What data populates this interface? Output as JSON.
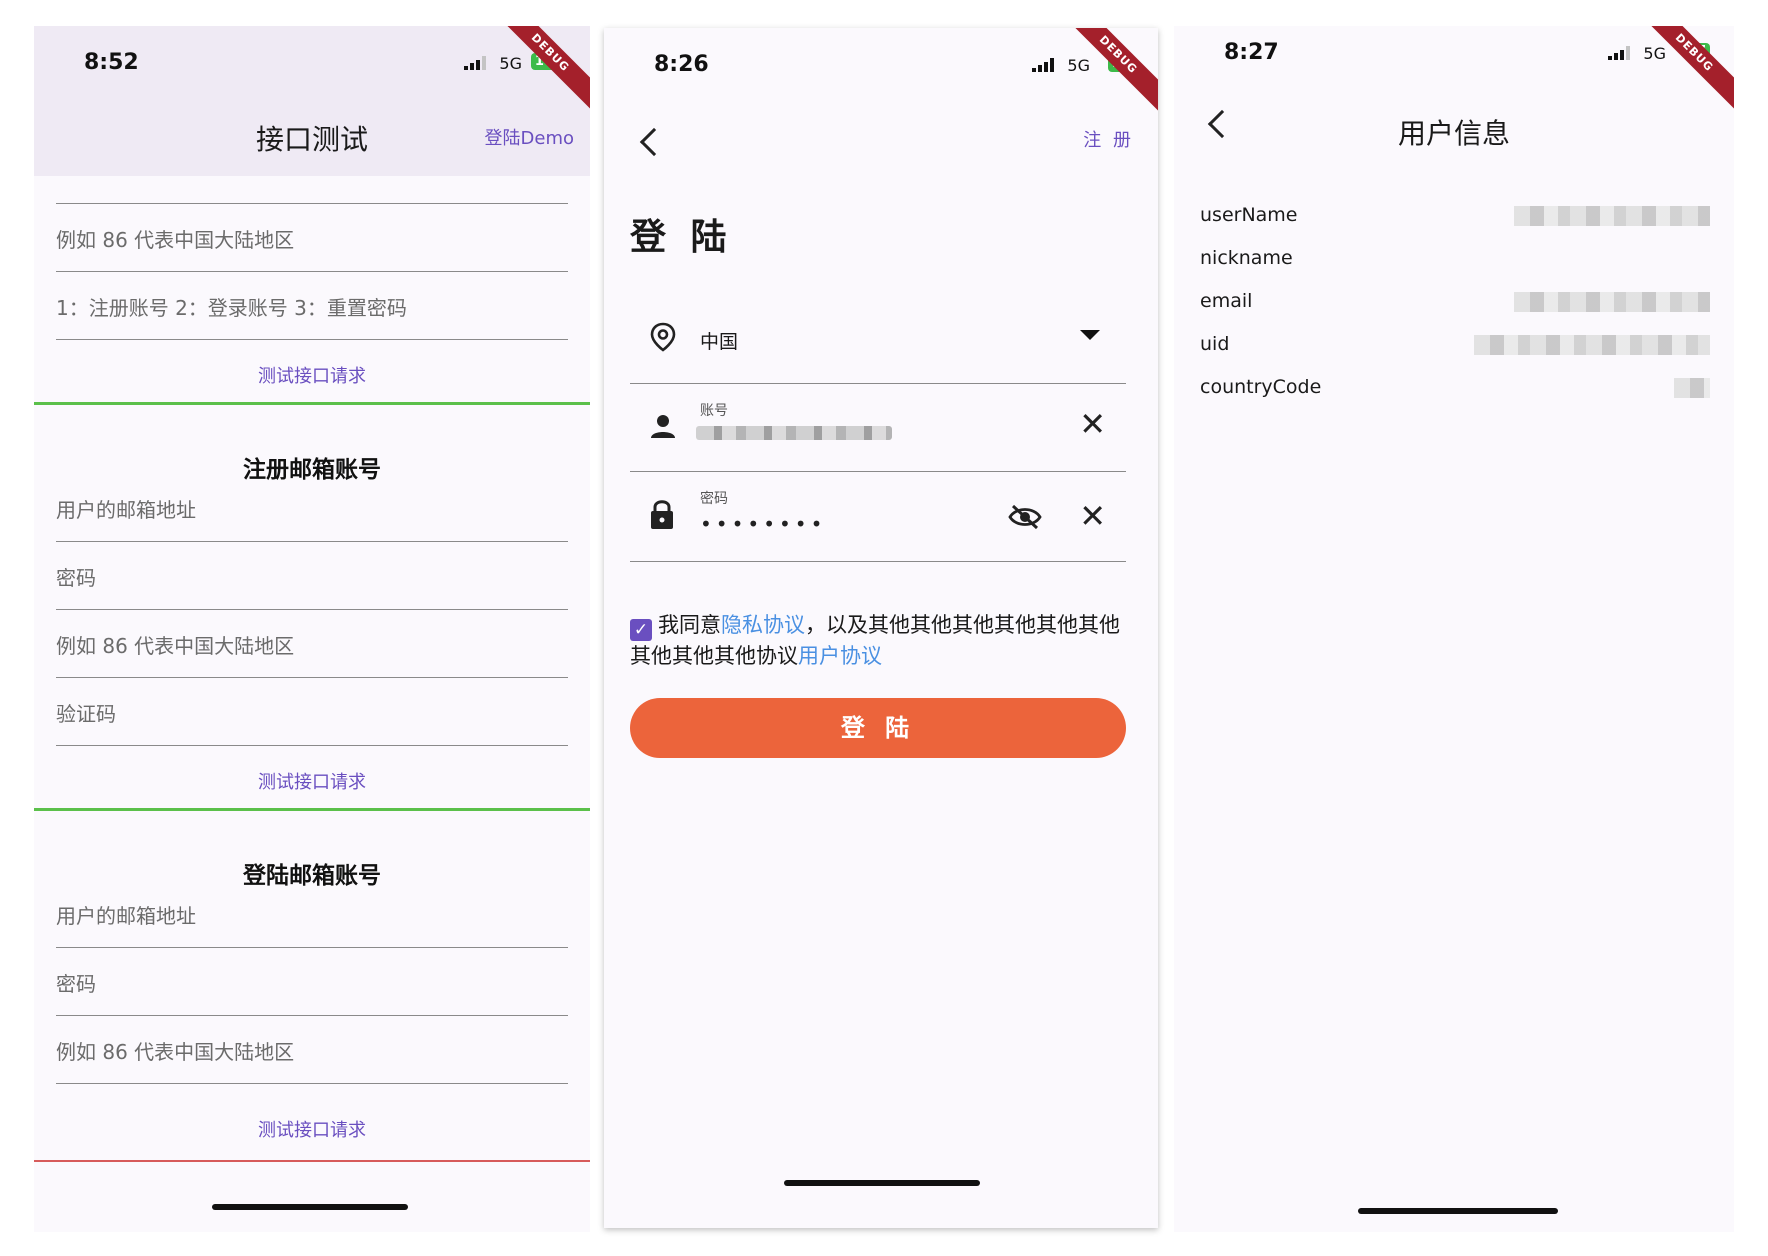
{
  "phone1": {
    "status": {
      "time": "8:52",
      "network": "5G",
      "battery": "100",
      "debug": "DEBUG"
    },
    "title": "接口测试",
    "demo_link": "登陆Demo",
    "section1": {
      "fields": [
        "例如 86 代表中国大陆地区",
        "1：注册账号 2：登录账号 3：重置密码"
      ],
      "button": "测试接口请求"
    },
    "section2": {
      "title": "注册邮箱账号",
      "fields": [
        "用户的邮箱地址",
        "密码",
        "例如 86 代表中国大陆地区",
        "验证码"
      ],
      "button": "测试接口请求"
    },
    "section3": {
      "title": "登陆邮箱账号",
      "fields": [
        "用户的邮箱地址",
        "密码",
        "例如 86 代表中国大陆地区"
      ],
      "button": "测试接口请求"
    }
  },
  "phone2": {
    "status": {
      "time": "8:26",
      "network": "5G",
      "battery": "97",
      "debug": "DEBUG"
    },
    "register_link": "注 册",
    "title": "登 陆",
    "country": "中国",
    "account_label": "账号",
    "password_label": "密码",
    "password_value": "••••••••",
    "agreement": {
      "prefix": "我同意",
      "privacy": "隐私协议",
      "middle": "，以及其他其他其他其他其他其他其他其他其他协议",
      "user": "用户协议"
    },
    "login_button": "登 陆"
  },
  "phone3": {
    "status": {
      "time": "8:27",
      "network": "5G",
      "battery": "97",
      "debug": "DEBUG"
    },
    "title": "用户信息",
    "rows": [
      {
        "key": "userName"
      },
      {
        "key": "nickname"
      },
      {
        "key": "email"
      },
      {
        "key": "uid"
      },
      {
        "key": "countryCode"
      }
    ]
  }
}
